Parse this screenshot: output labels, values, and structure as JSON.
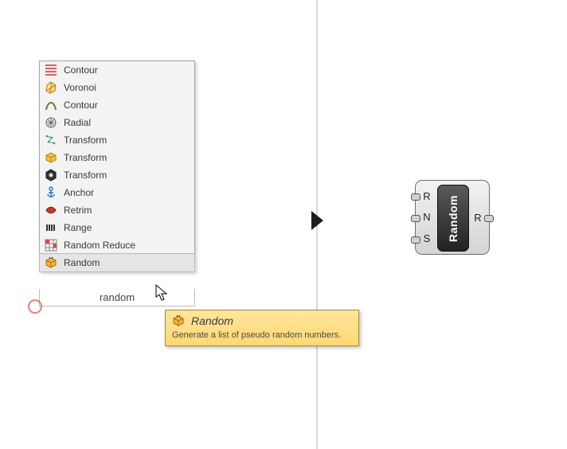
{
  "menu": {
    "items": [
      {
        "label": "Contour",
        "icon": "contour-lines-icon"
      },
      {
        "label": "Voronoi",
        "icon": "voronoi-icon"
      },
      {
        "label": "Contour",
        "icon": "curve-icon"
      },
      {
        "label": "Radial",
        "icon": "radial-icon"
      },
      {
        "label": "Transform",
        "icon": "transform-points-icon"
      },
      {
        "label": "Transform",
        "icon": "transform-box-icon"
      },
      {
        "label": "Transform",
        "icon": "transform-hex-icon"
      },
      {
        "label": "Anchor",
        "icon": "anchor-icon"
      },
      {
        "label": "Retrim",
        "icon": "retrim-icon"
      },
      {
        "label": "Range",
        "icon": "range-icon"
      },
      {
        "label": "Random Reduce",
        "icon": "grid-icon"
      },
      {
        "label": "Random",
        "icon": "random-box-icon",
        "selected": true
      }
    ]
  },
  "search": {
    "value": "random"
  },
  "tooltip": {
    "title": "Random",
    "body": "Generate a list of pseudo random numbers.",
    "icon": "random-box-icon"
  },
  "component": {
    "name": "Random",
    "inputs": [
      "R",
      "N",
      "S"
    ],
    "outputs": [
      "R"
    ]
  }
}
